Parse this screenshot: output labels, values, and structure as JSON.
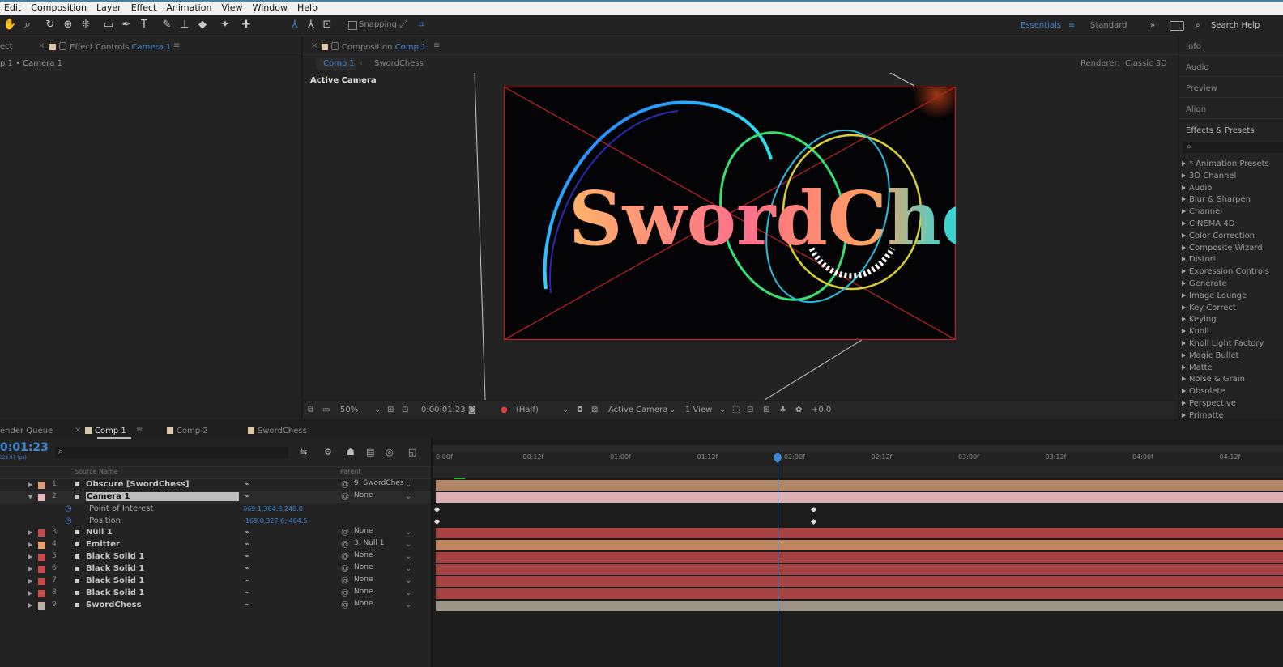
{
  "menu": [
    "Edit",
    "Composition",
    "Layer",
    "Effect",
    "Animation",
    "View",
    "Window",
    "Help"
  ],
  "toolbar": {
    "snapping_label": "Snapping",
    "workspaces": [
      "Essentials",
      "Standard"
    ],
    "search_help": "Search Help"
  },
  "effect_controls": {
    "left_tab": "ect",
    "tab_prefix": "Effect Controls",
    "tab_target": "Camera 1",
    "breadcrumb": "p 1 • Camera 1"
  },
  "composition": {
    "tab_prefix": "Composition",
    "tab_target": "Comp 1",
    "breadcrumb": [
      "Comp 1",
      "SwordChess"
    ],
    "renderer_label": "Renderer:",
    "renderer_value": "Classic 3D",
    "view_label": "Active Camera",
    "canvas_text": "SwordChess"
  },
  "viewer_bar": {
    "zoom": "50%",
    "timecode": "0:00:01:23",
    "resolution": "(Half)",
    "camera": "Active Camera",
    "views": "1 View",
    "exposure": "+0.0"
  },
  "right_panel": {
    "headers": [
      "Info",
      "Audio",
      "Preview",
      "Align",
      "Effects & Presets"
    ],
    "effects": [
      "* Animation Presets",
      "3D Channel",
      "Audio",
      "Blur & Sharpen",
      "Channel",
      "CINEMA 4D",
      "Color Correction",
      "Composite Wizard",
      "Distort",
      "Expression Controls",
      "Generate",
      "Image Lounge",
      "Key Correct",
      "Keying",
      "Knoll",
      "Knoll Light Factory",
      "Magic Bullet",
      "Matte",
      "Noise & Grain",
      "Obsolete",
      "Perspective",
      "Primatte"
    ]
  },
  "timeline": {
    "tabs": [
      "ender Queue",
      "Comp 1",
      "Comp 2",
      "SwordChess"
    ],
    "timecode": "0:01:23",
    "col_source": "Source Name",
    "col_parent": "Parent",
    "ruler": [
      "0:00f",
      "00:12f",
      "01:00f",
      "01:12f",
      "02:00f",
      "02:12f",
      "03:00f",
      "03:12f",
      "04:00f",
      "04:12f"
    ],
    "layers": [
      {
        "num": "1",
        "name": "Obscure [SwordChess]",
        "parent": "9. SwordChes",
        "color": "#d9a07a"
      },
      {
        "num": "2",
        "name": "Camera 1",
        "parent": "None",
        "color": "#e8b8bc"
      },
      {
        "num": "3",
        "name": "Null 1",
        "parent": "None",
        "color": "#c94c4c"
      },
      {
        "num": "4",
        "name": "Emitter",
        "parent": "3. Null 1",
        "color": "#e8a070"
      },
      {
        "num": "5",
        "name": "Black Solid 1",
        "parent": "None",
        "color": "#c94c4c"
      },
      {
        "num": "6",
        "name": "Black Solid 1",
        "parent": "None",
        "color": "#c94c4c"
      },
      {
        "num": "7",
        "name": "Black Solid 1",
        "parent": "None",
        "color": "#c94c4c"
      },
      {
        "num": "8",
        "name": "Black Solid 1",
        "parent": "None",
        "color": "#c94c4c"
      },
      {
        "num": "9",
        "name": "SwordChess",
        "parent": "None",
        "color": "#bdb0a0"
      }
    ],
    "props": [
      {
        "name": "Point of Interest",
        "value": "669.1,384.8,248.0"
      },
      {
        "name": "Position",
        "value": "-169.0,327.6,-464.5"
      }
    ]
  }
}
